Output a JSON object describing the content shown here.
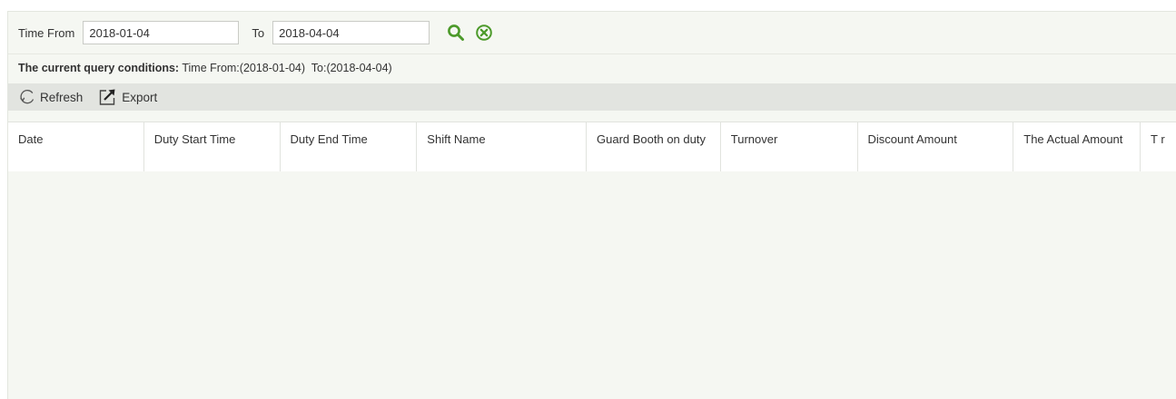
{
  "filter": {
    "time_from_label": "Time From",
    "time_from_value": "2018-01-04",
    "to_label": "To",
    "to_value": "2018-04-04",
    "search_icon": "search-icon",
    "clear_icon": "clear-circle-icon"
  },
  "query": {
    "heading": "The current query conditions:",
    "text": " Time From:(2018-01-04)  To:(2018-04-04)"
  },
  "toolbar": {
    "refresh_label": "Refresh",
    "refresh_icon": "refresh-icon",
    "export_label": "Export",
    "export_icon": "export-icon"
  },
  "table": {
    "columns": [
      "Date",
      "Duty Start Time",
      "Duty End Time",
      "Shift Name",
      "Guard Booth on duty",
      "Turnover",
      "Discount Amount",
      "The Actual Amount",
      "T r"
    ],
    "rows": []
  },
  "colors": {
    "accent_green": "#4c9a2a",
    "panel_background": "#f5f7f2",
    "toolbar_background": "#e2e4e0"
  }
}
